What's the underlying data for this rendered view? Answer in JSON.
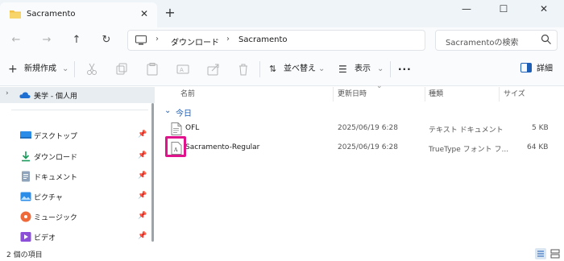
{
  "tab": {
    "title": "Sacramento"
  },
  "window_controls": {
    "minimize": "—",
    "maximize": "☐",
    "close": "✕"
  },
  "address": {
    "parts": [
      "ダウンロード",
      "Sacramento"
    ],
    "search_placeholder": "Sacramentoの検索"
  },
  "commands": {
    "new": "新規作成",
    "sort": "並べ替え",
    "view": "表示",
    "more": "···",
    "details": "詳細"
  },
  "sidebar": {
    "top": "美学 - 個人用",
    "items": [
      {
        "label": "デスクトップ",
        "icon": "desktop-icon"
      },
      {
        "label": "ダウンロード",
        "icon": "download-icon"
      },
      {
        "label": "ドキュメント",
        "icon": "document-icon"
      },
      {
        "label": "ピクチャ",
        "icon": "picture-icon"
      },
      {
        "label": "ミュージック",
        "icon": "music-icon"
      },
      {
        "label": "ビデオ",
        "icon": "video-icon"
      }
    ]
  },
  "columns": {
    "name": "名前",
    "modified": "更新日時",
    "type": "種類",
    "size": "サイズ"
  },
  "group": "今日",
  "files": [
    {
      "name": "OFL",
      "modified": "2025/06/19 6:28",
      "type": "テキスト ドキュメント",
      "size": "5 KB",
      "icon": "text-file-icon"
    },
    {
      "name": "Sacramento-Regular",
      "modified": "2025/06/19 6:28",
      "type": "TrueType フォント フ...",
      "size": "64 KB",
      "icon": "font-file-icon"
    }
  ],
  "status": {
    "count": "2 個の項目"
  },
  "colors": {
    "accent": "#1d5fb7",
    "highlight": "#e0138c"
  }
}
